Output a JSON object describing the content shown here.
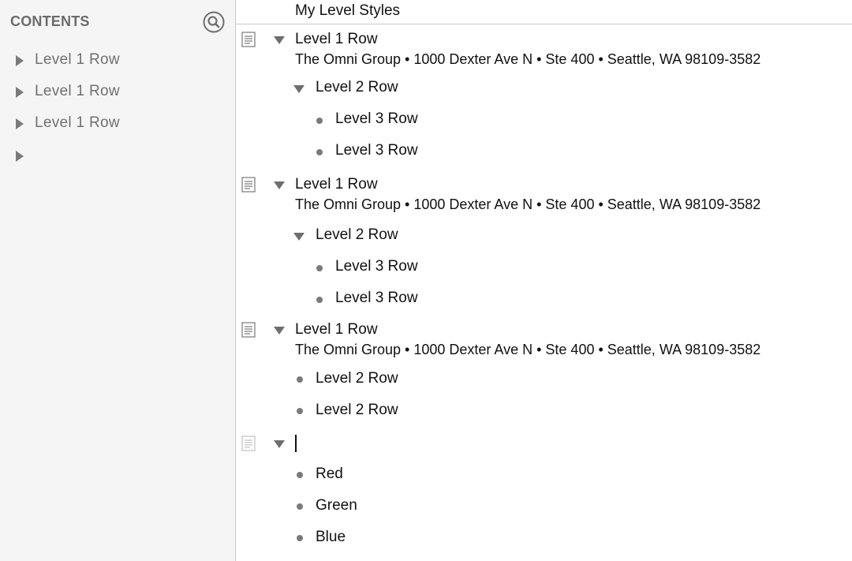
{
  "sidebar": {
    "header": "CONTENTS",
    "items": [
      {
        "label": "Level 1 Row"
      },
      {
        "label": "Level 1 Row"
      },
      {
        "label": "Level 1 Row"
      },
      {
        "label": ""
      }
    ]
  },
  "outline": {
    "column_title": "My Level Styles",
    "groups": [
      {
        "title": "Level 1 Row",
        "note": "The Omni Group • 1000 Dexter Ave N • Ste 400 • Seattle, WA 98109-3582",
        "children": [
          {
            "title": "Level 2 Row",
            "children": [
              {
                "title": "Level 3 Row"
              },
              {
                "title": "Level 3 Row"
              }
            ]
          }
        ]
      },
      {
        "title": "Level 1 Row",
        "note": "The Omni Group • 1000 Dexter Ave N • Ste 400 • Seattle, WA 98109-3582",
        "children": [
          {
            "title": "Level 2 Row",
            "children": [
              {
                "title": "Level 3 Row"
              },
              {
                "title": "Level 3 Row"
              }
            ]
          }
        ]
      },
      {
        "title": "Level 1 Row",
        "note": "The Omni Group • 1000 Dexter Ave N • Ste 400 • Seattle, WA 98109-3582",
        "children": [
          {
            "title": "Level 2 Row"
          },
          {
            "title": "Level 2 Row"
          }
        ]
      },
      {
        "title": "",
        "note": "",
        "children": [
          {
            "title": "Red"
          },
          {
            "title": "Green"
          },
          {
            "title": "Blue"
          }
        ]
      }
    ]
  },
  "icons": {
    "search": "magnifier-circle-icon",
    "note": "note-page-icon",
    "expand": "disclosure-triangle-icon",
    "bullet": "bullet-dot-icon"
  },
  "colors": {
    "sidebar_bg": "#f5f5f5",
    "sidebar_text": "#707070",
    "row_text": "#111111",
    "divider": "#c9c9c9"
  }
}
